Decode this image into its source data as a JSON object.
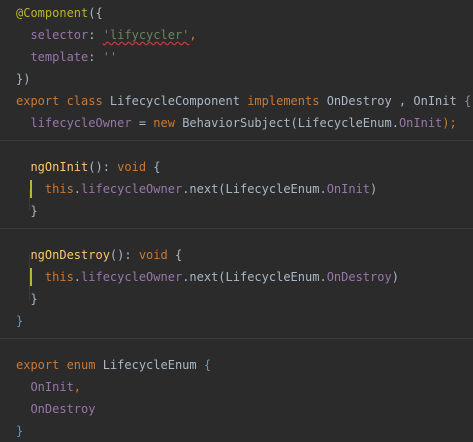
{
  "editor": {
    "lines": [
      [
        {
          "t": "@Component",
          "c": "t-dec"
        },
        {
          "t": "({",
          "c": "t-bracket"
        }
      ],
      [
        {
          "t": "  selector",
          "c": "t-field"
        },
        {
          "t": ": ",
          "c": "t-bracket"
        },
        {
          "t": "'lifycycler'",
          "c": "t-str squiggle"
        },
        {
          "t": ",",
          "c": "t-punc"
        }
      ],
      [
        {
          "t": "  template",
          "c": "t-field"
        },
        {
          "t": ": ",
          "c": "t-bracket"
        },
        {
          "t": "''",
          "c": "t-str"
        }
      ],
      [
        {
          "t": "})",
          "c": "t-bracket"
        }
      ],
      [
        {
          "t": "export class ",
          "c": "t-kw"
        },
        {
          "t": "LifecycleComponent ",
          "c": "t-type"
        },
        {
          "t": "implements ",
          "c": "t-kw"
        },
        {
          "t": "OnDestroy , OnInit ",
          "c": "t-type"
        },
        {
          "t": "{",
          "c": "t-brace-hl"
        }
      ],
      [
        {
          "t": "  lifecycleOwner",
          "c": "t-field"
        },
        {
          "t": " = ",
          "c": "t-bracket"
        },
        {
          "t": "new ",
          "c": "t-kw"
        },
        {
          "t": "BehaviorSubject(LifecycleEnum.",
          "c": "t-type"
        },
        {
          "t": "OnInit",
          "c": "t-field"
        },
        {
          "t": ");",
          "c": "t-punc"
        }
      ],
      [],
      [
        {
          "t": "  ngOnInit",
          "c": "t-fn"
        },
        {
          "t": "(): ",
          "c": "t-bracket"
        },
        {
          "t": "void ",
          "c": "t-kw"
        },
        {
          "t": "{",
          "c": "t-bracket"
        }
      ],
      [
        {
          "t": "    this",
          "c": "t-kw"
        },
        {
          "t": ".",
          "c": "t-bracket"
        },
        {
          "t": "lifecycleOwner",
          "c": "t-field"
        },
        {
          "t": ".next(LifecycleEnum.",
          "c": "t-type"
        },
        {
          "t": "OnInit",
          "c": "t-field"
        },
        {
          "t": ")",
          "c": "t-bracket"
        }
      ],
      [
        {
          "t": "  }",
          "c": "t-bracket"
        }
      ],
      [],
      [
        {
          "t": "  ngOnDestroy",
          "c": "t-fn"
        },
        {
          "t": "(): ",
          "c": "t-bracket"
        },
        {
          "t": "void ",
          "c": "t-kw"
        },
        {
          "t": "{",
          "c": "t-bracket"
        }
      ],
      [
        {
          "t": "    this",
          "c": "t-kw"
        },
        {
          "t": ".",
          "c": "t-bracket"
        },
        {
          "t": "lifecycleOwner",
          "c": "t-field"
        },
        {
          "t": ".next(LifecycleEnum.",
          "c": "t-type"
        },
        {
          "t": "OnDestroy",
          "c": "t-field"
        },
        {
          "t": ")",
          "c": "t-bracket"
        }
      ],
      [
        {
          "t": "  }",
          "c": "t-bracket"
        }
      ],
      [
        {
          "t": "}",
          "c": "t-brace-hl"
        }
      ],
      [],
      [
        {
          "t": "export enum ",
          "c": "t-kw"
        },
        {
          "t": "LifecycleEnum ",
          "c": "t-type"
        },
        {
          "t": "{",
          "c": "t-brace-hl"
        }
      ],
      [
        {
          "t": "  OnInit",
          "c": "t-field"
        },
        {
          "t": ",",
          "c": "t-punc"
        }
      ],
      [
        {
          "t": "  OnDestroy",
          "c": "t-field"
        }
      ],
      [
        {
          "t": "}",
          "c": "t-brace-hl"
        }
      ]
    ]
  }
}
